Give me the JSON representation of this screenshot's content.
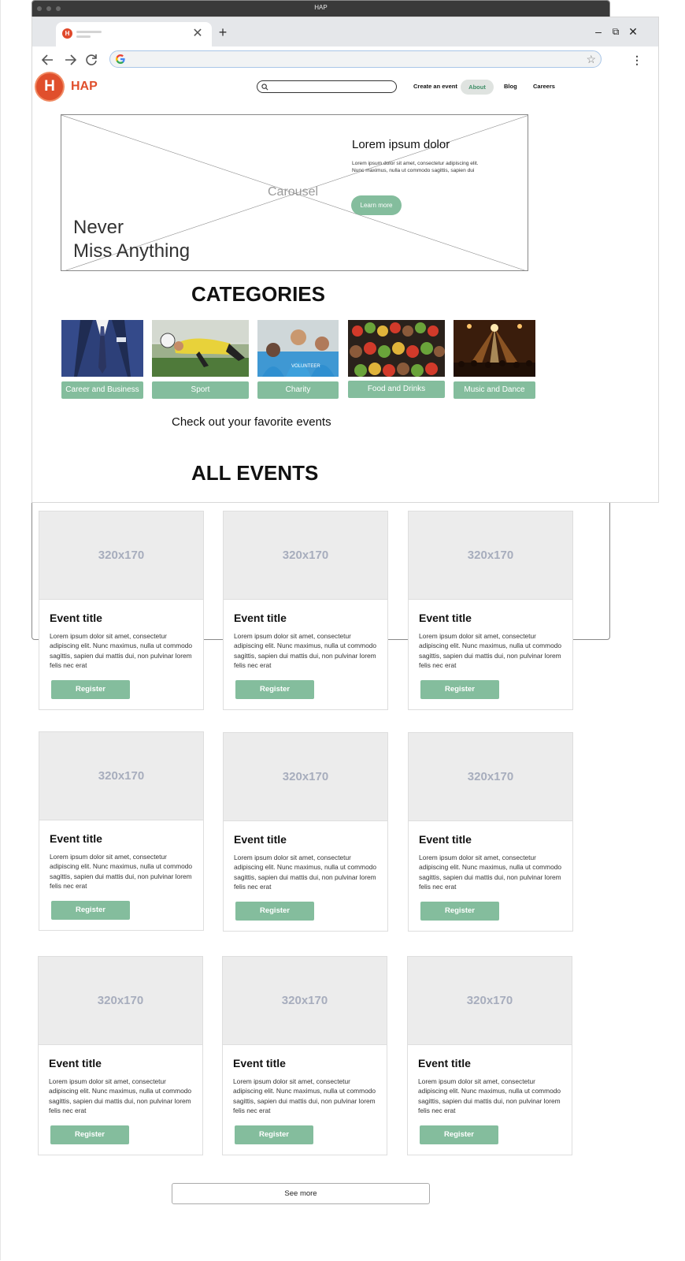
{
  "back_window": {
    "title": "HAP"
  },
  "browser": {
    "new_tab_symbol": "+",
    "tab_close_symbol": "✕",
    "controls": {
      "minimize": "–",
      "restore": "⧉",
      "close": "✕"
    },
    "omnibox_value": "",
    "icons": [
      "back-arrow",
      "forward-arrow",
      "reload",
      "google-logo",
      "bookmark-star",
      "menu-dots"
    ]
  },
  "site": {
    "logo_letter": "H",
    "logo_text": "HAP",
    "search_placeholder": "",
    "nav": {
      "create_event": "Create an event",
      "about": "About",
      "blog": "Blog",
      "careers": "Careers"
    },
    "accent_color": "#84bd9d",
    "brand_color": "#e04f2c"
  },
  "carousel": {
    "placeholder_label": "Carousel",
    "hero_line1": "Never",
    "hero_line2": "Miss Anything",
    "slide_title": "Lorem ipsum dolor",
    "slide_text": "Lorem ipsum dolor sit amet, consectetur adipiscing elit. Nunc maximus, nulla ut commodo sagittis, sapien dui",
    "button_label": "Learn more"
  },
  "categories": {
    "heading": "CATEGORIES",
    "items": [
      {
        "label": "Career and Business",
        "image": "business-suit-photo"
      },
      {
        "label": "Sport",
        "image": "soccer-goalkeeper-photo"
      },
      {
        "label": "Charity",
        "image": "volunteers-photo"
      },
      {
        "label": "Food and Drinks",
        "image": "skewers-photo"
      },
      {
        "label": "Music and Dance",
        "image": "concert-photo"
      }
    ],
    "subtext": "Check out your favorite events"
  },
  "events": {
    "heading": "ALL EVENTS",
    "cards": [
      {
        "image_label": "320x170",
        "title": "Event title",
        "text": "Lorem ipsum dolor sit amet, consectetur adipiscing elit. Nunc maximus, nulla ut commodo sagittis, sapien dui mattis dui, non pulvinar lorem felis nec erat",
        "button": "Register"
      },
      {
        "image_label": "320x170",
        "title": "Event title",
        "text": "Lorem ipsum dolor sit amet, consectetur adipiscing elit. Nunc maximus, nulla ut commodo sagittis, sapien dui mattis dui, non pulvinar lorem felis nec erat",
        "button": "Register"
      },
      {
        "image_label": "320x170",
        "title": "Event title",
        "text": "Lorem ipsum dolor sit amet, consectetur adipiscing elit. Nunc maximus, nulla ut commodo sagittis, sapien dui mattis dui, non pulvinar lorem felis nec erat",
        "button": "Register"
      },
      {
        "image_label": "320x170",
        "title": "Event title",
        "text": "Lorem ipsum dolor sit amet, consectetur adipiscing elit. Nunc maximus, nulla ut commodo sagittis, sapien dui mattis dui, non pulvinar lorem felis nec erat",
        "button": "Register"
      },
      {
        "image_label": "320x170",
        "title": "Event title",
        "text": "Lorem ipsum dolor sit amet, consectetur adipiscing elit. Nunc maximus, nulla ut commodo sagittis, sapien dui mattis dui, non pulvinar lorem felis nec erat",
        "button": "Register"
      },
      {
        "image_label": "320x170",
        "title": "Event title",
        "text": "Lorem ipsum dolor sit amet, consectetur adipiscing elit. Nunc maximus, nulla ut commodo sagittis, sapien dui mattis dui, non pulvinar lorem felis nec erat",
        "button": "Register"
      },
      {
        "image_label": "320x170",
        "title": "Event title",
        "text": "Lorem ipsum dolor sit amet, consectetur adipiscing elit. Nunc maximus, nulla ut commodo sagittis, sapien dui mattis dui, non pulvinar lorem felis nec erat",
        "button": "Register"
      },
      {
        "image_label": "320x170",
        "title": "Event title",
        "text": "Lorem ipsum dolor sit amet, consectetur adipiscing elit. Nunc maximus, nulla ut commodo sagittis, sapien dui mattis dui, non pulvinar lorem felis nec erat",
        "button": "Register"
      },
      {
        "image_label": "320x170",
        "title": "Event title",
        "text": "Lorem ipsum dolor sit amet, consectetur adipiscing elit. Nunc maximus, nulla ut commodo sagittis, sapien dui mattis dui, non pulvinar lorem felis nec erat",
        "button": "Register"
      }
    ],
    "see_more": "See more"
  }
}
